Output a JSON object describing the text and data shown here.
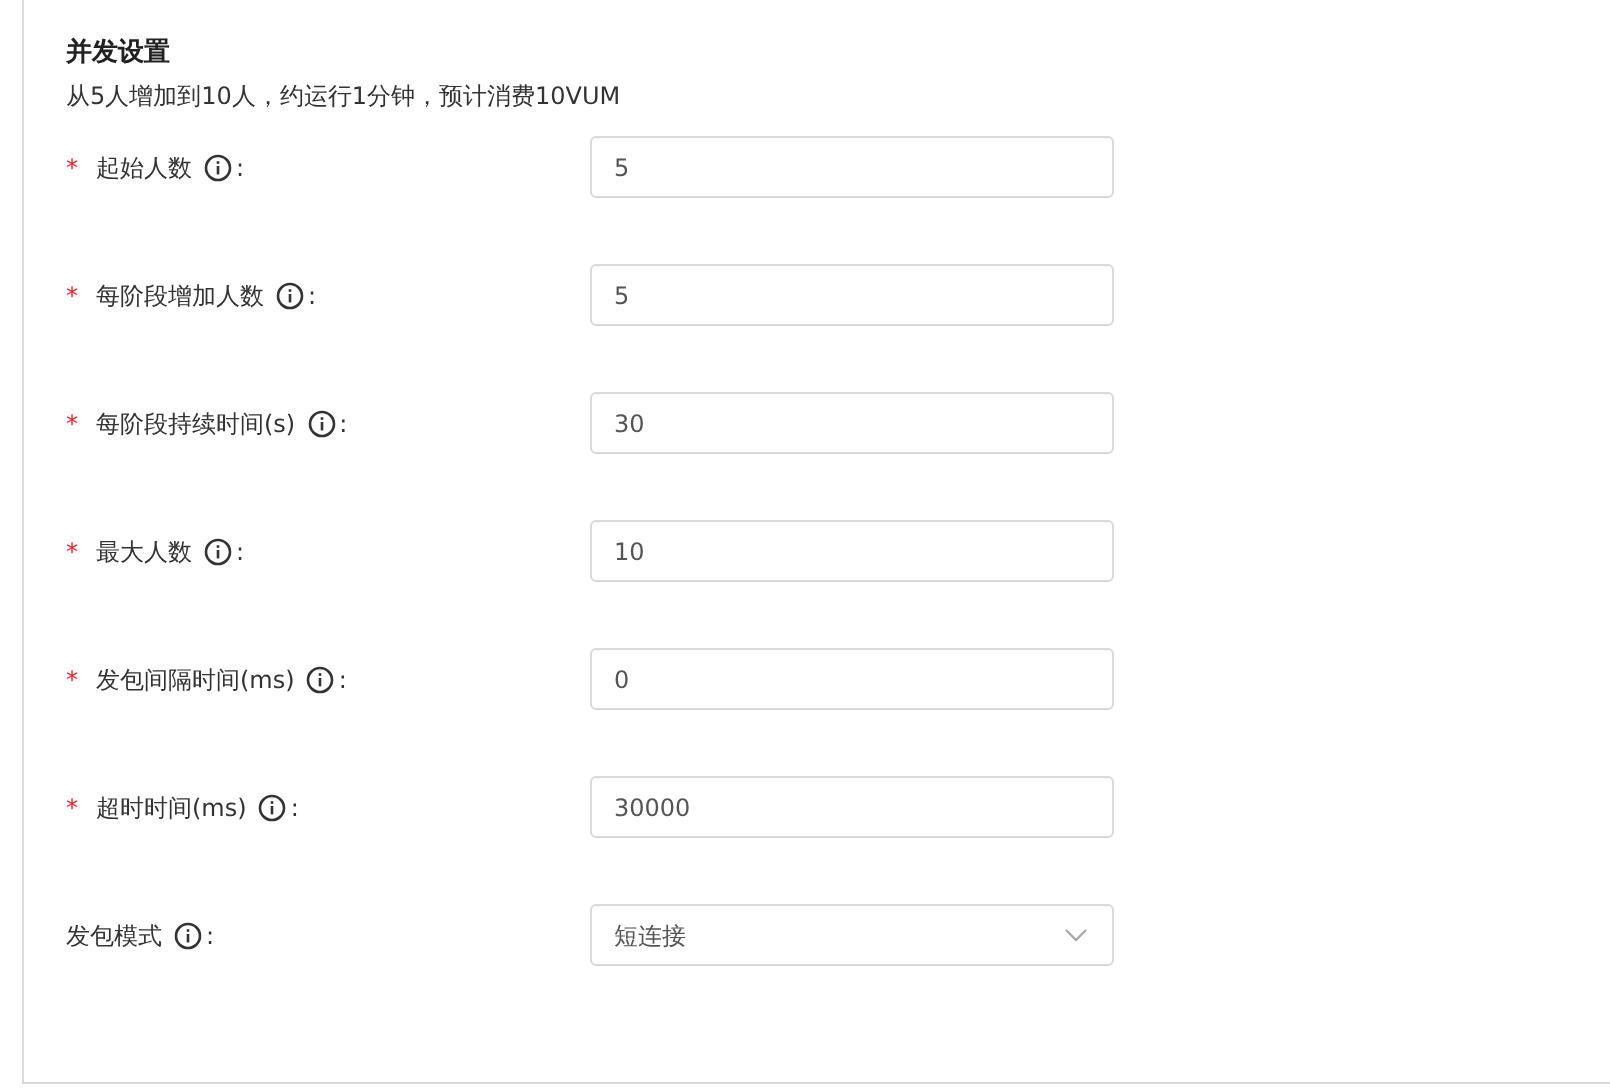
{
  "section": {
    "title": "并发设置",
    "summary": "从5人增加到10人，约运行1分钟，预计消费10VUM"
  },
  "fields": [
    {
      "kind": "input",
      "required_mark": "*",
      "label": "起始人数",
      "suffix": ":",
      "value": "5"
    },
    {
      "kind": "input",
      "required_mark": "*",
      "label": "每阶段增加人数",
      "suffix": ":",
      "value": "5"
    },
    {
      "kind": "input",
      "required_mark": "*",
      "label": "每阶段持续时间(s)",
      "suffix": ":",
      "value": "30"
    },
    {
      "kind": "input",
      "required_mark": "*",
      "label": "最大人数",
      "suffix": ":",
      "value": "10"
    },
    {
      "kind": "input",
      "required_mark": "*",
      "label": "发包间隔时间(ms)",
      "suffix": ":",
      "value": "0"
    },
    {
      "kind": "input",
      "required_mark": "*",
      "label": "超时时间(ms)",
      "suffix": ":",
      "value": "30000"
    },
    {
      "kind": "select",
      "label": "发包模式",
      "suffix": ":",
      "value": "短连接"
    }
  ]
}
